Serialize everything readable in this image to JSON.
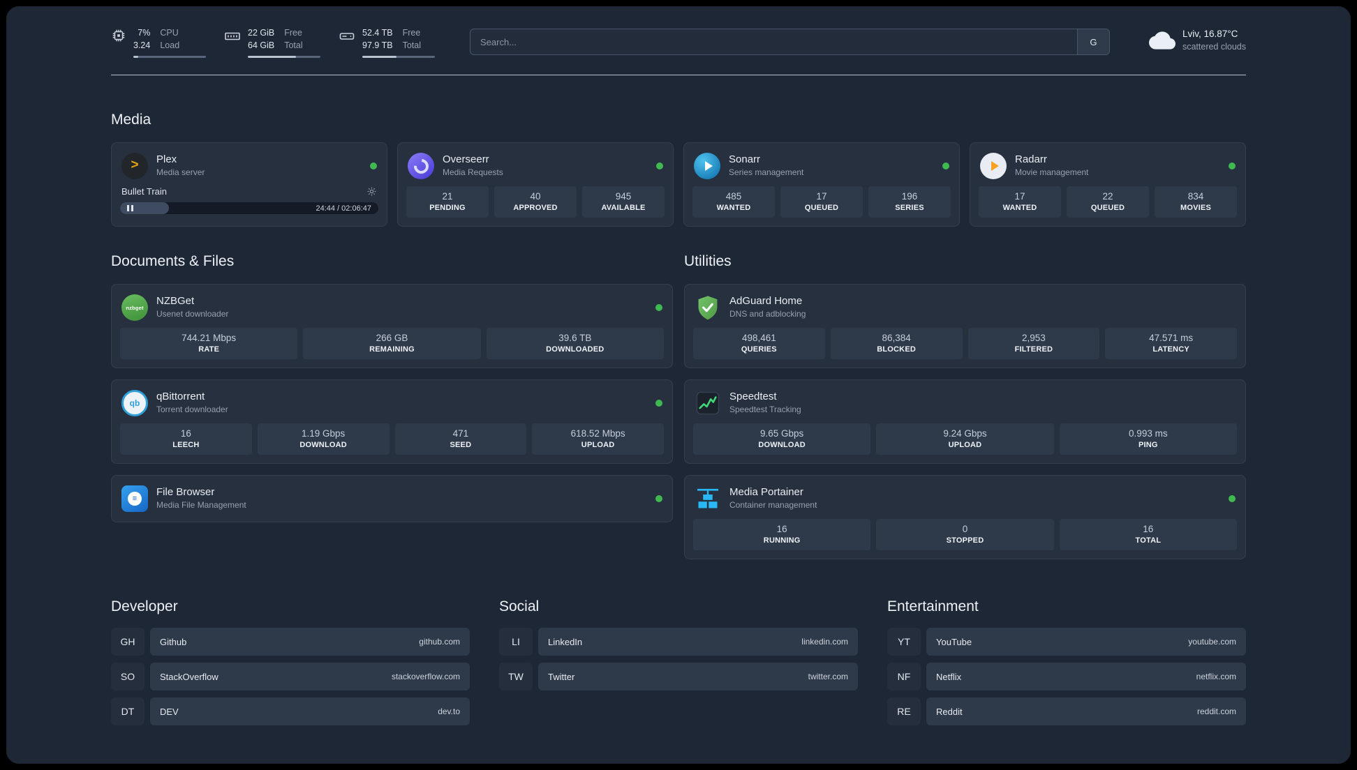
{
  "topbar": {
    "cpu": {
      "value_top": "7%",
      "value_bottom": "3.24",
      "label_top": "CPU",
      "label_bottom": "Load",
      "progress": "7"
    },
    "memory": {
      "value_top": "22 GiB",
      "value_bottom": "64 GiB",
      "label_top": "Free",
      "label_bottom": "Total",
      "progress": "66"
    },
    "disk": {
      "value_top": "52.4 TB",
      "value_bottom": "97.9 TB",
      "label_top": "Free",
      "label_bottom": "Total",
      "progress": "47"
    },
    "search": {
      "placeholder": "Search...",
      "provider": "G"
    },
    "weather": {
      "location": "Lviv, 16.87°C",
      "condition": "scattered clouds"
    }
  },
  "media": {
    "title": "Media",
    "plex": {
      "name": "Plex",
      "subtitle": "Media server",
      "now_playing": "Bullet Train",
      "time": "24:44 / 02:06:47",
      "progress": "19"
    },
    "overseerr": {
      "name": "Overseerr",
      "subtitle": "Media Requests",
      "stats": [
        {
          "value": "21",
          "label": "PENDING"
        },
        {
          "value": "40",
          "label": "APPROVED"
        },
        {
          "value": "945",
          "label": "AVAILABLE"
        }
      ]
    },
    "sonarr": {
      "name": "Sonarr",
      "subtitle": "Series management",
      "stats": [
        {
          "value": "485",
          "label": "WANTED"
        },
        {
          "value": "17",
          "label": "QUEUED"
        },
        {
          "value": "196",
          "label": "SERIES"
        }
      ]
    },
    "radarr": {
      "name": "Radarr",
      "subtitle": "Movie management",
      "stats": [
        {
          "value": "17",
          "label": "WANTED"
        },
        {
          "value": "22",
          "label": "QUEUED"
        },
        {
          "value": "834",
          "label": "MOVIES"
        }
      ]
    }
  },
  "documents": {
    "title": "Documents & Files",
    "nzbget": {
      "name": "NZBGet",
      "subtitle": "Usenet downloader",
      "icon_text": "nzbget",
      "stats": [
        {
          "value": "744.21 Mbps",
          "label": "RATE"
        },
        {
          "value": "266 GB",
          "label": "REMAINING"
        },
        {
          "value": "39.6 TB",
          "label": "DOWNLOADED"
        }
      ]
    },
    "qbittorrent": {
      "name": "qBittorrent",
      "subtitle": "Torrent downloader",
      "icon_text": "qb",
      "stats": [
        {
          "value": "16",
          "label": "LEECH"
        },
        {
          "value": "1.19 Gbps",
          "label": "DOWNLOAD"
        },
        {
          "value": "471",
          "label": "SEED"
        },
        {
          "value": "618.52 Mbps",
          "label": "UPLOAD"
        }
      ]
    },
    "filebrowser": {
      "name": "File Browser",
      "subtitle": "Media File Management"
    }
  },
  "utilities": {
    "title": "Utilities",
    "adguard": {
      "name": "AdGuard Home",
      "subtitle": "DNS and adblocking",
      "stats": [
        {
          "value": "498,461",
          "label": "QUERIES"
        },
        {
          "value": "86,384",
          "label": "BLOCKED"
        },
        {
          "value": "2,953",
          "label": "FILTERED"
        },
        {
          "value": "47.571 ms",
          "label": "LATENCY"
        }
      ]
    },
    "speedtest": {
      "name": "Speedtest",
      "subtitle": "Speedtest Tracking",
      "stats": [
        {
          "value": "9.65 Gbps",
          "label": "DOWNLOAD"
        },
        {
          "value": "9.24 Gbps",
          "label": "UPLOAD"
        },
        {
          "value": "0.993 ms",
          "label": "PING"
        }
      ]
    },
    "portainer": {
      "name": "Media Portainer",
      "subtitle": "Container management",
      "stats": [
        {
          "value": "16",
          "label": "RUNNING"
        },
        {
          "value": "0",
          "label": "STOPPED"
        },
        {
          "value": "16",
          "label": "TOTAL"
        }
      ]
    }
  },
  "bookmarks": [
    {
      "title": "Developer",
      "items": [
        {
          "abbr": "GH",
          "name": "Github",
          "url": "github.com"
        },
        {
          "abbr": "SO",
          "name": "StackOverflow",
          "url": "stackoverflow.com"
        },
        {
          "abbr": "DT",
          "name": "DEV",
          "url": "dev.to"
        }
      ]
    },
    {
      "title": "Social",
      "items": [
        {
          "abbr": "LI",
          "name": "LinkedIn",
          "url": "linkedin.com"
        },
        {
          "abbr": "TW",
          "name": "Twitter",
          "url": "twitter.com"
        }
      ]
    },
    {
      "title": "Entertainment",
      "items": [
        {
          "abbr": "YT",
          "name": "YouTube",
          "url": "youtube.com"
        },
        {
          "abbr": "NF",
          "name": "Netflix",
          "url": "netflix.com"
        },
        {
          "abbr": "RE",
          "name": "Reddit",
          "url": "reddit.com"
        }
      ]
    }
  ],
  "colors": {
    "status_ok": "#3fb950",
    "accent_amber": "#e5a00d",
    "accent_blue": "#29b8f5",
    "accent_green": "#41d97a"
  }
}
